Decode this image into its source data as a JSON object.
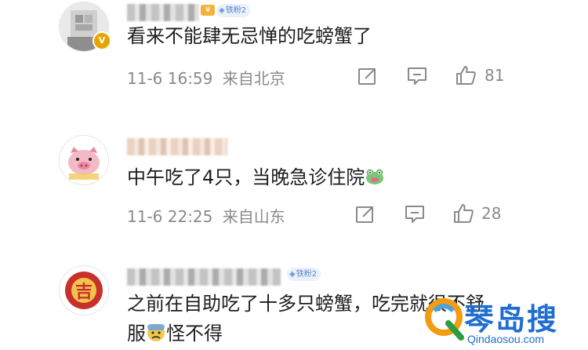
{
  "comments": [
    {
      "content": "看来不能肆无忌惮的吃螃蟹了",
      "date": "11-6 16:59",
      "location": "来自北京",
      "likes": "81",
      "badge_label": "铁粉2",
      "avatar_icon": "blurred-portrait-icon",
      "verified_icon": "verified-v-icon"
    },
    {
      "content": "中午吃了4只，当晚急诊住院",
      "date": "11-6 22:25",
      "location": "来自山东",
      "likes": "28",
      "avatar_icon": "pink-pig-avatar-icon",
      "emoji_icon": "frog-emoji-icon"
    },
    {
      "content_line1": "之前在自助吃了十多只螃蟹，吃完就很不舒",
      "content_line2_a": "服",
      "content_line2_b": "怪不得",
      "badge_label": "铁粉2",
      "avatar_icon": "red-logo-avatar-icon",
      "emoji_icon": "worried-face-emoji-icon"
    }
  ],
  "icons": {
    "repost": "repost-icon",
    "comment": "comment-icon",
    "like": "like-thumb-icon"
  },
  "watermark": {
    "title": "琴岛搜",
    "url": "Qindaosou.com"
  }
}
